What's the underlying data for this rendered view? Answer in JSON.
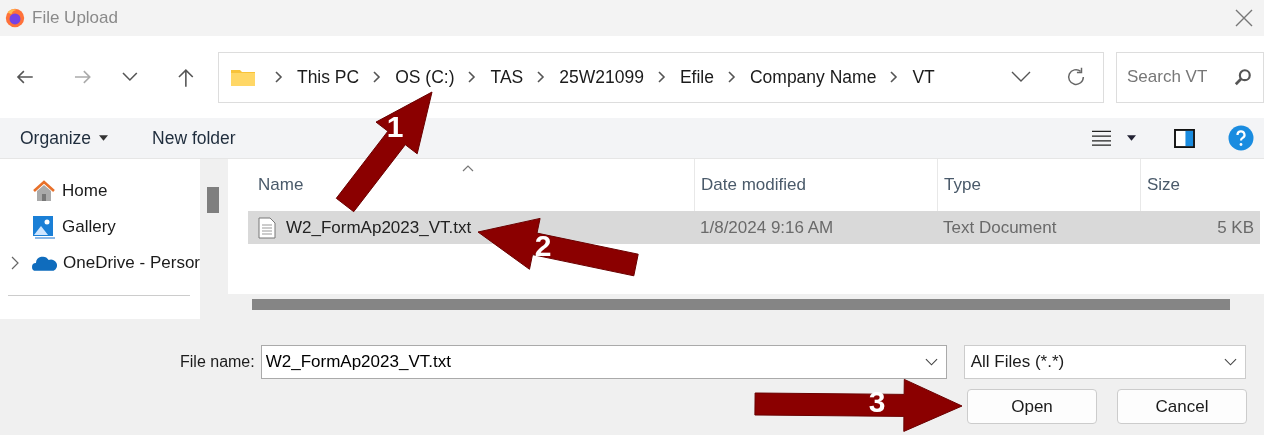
{
  "window": {
    "title": "File Upload"
  },
  "nav": {
    "breadcrumb": [
      "This PC",
      "OS (C:)",
      "TAS",
      "25W21099",
      "Efile",
      "Company Name",
      "VT"
    ],
    "search": {
      "placeholder": "Search VT"
    }
  },
  "toolbar": {
    "organize": "Organize",
    "new_folder": "New folder"
  },
  "sidebar": {
    "items": [
      {
        "label": "Home",
        "kind": "home",
        "expandable": false
      },
      {
        "label": "Gallery",
        "kind": "gallery",
        "expandable": false
      },
      {
        "label": "OneDrive - Persor",
        "kind": "cloud",
        "expandable": true
      }
    ]
  },
  "table": {
    "columns": [
      "Name",
      "Date modified",
      "Type",
      "Size"
    ],
    "rows": [
      {
        "name": "W2_FormAp2023_VT.txt",
        "date": "1/8/2024 9:16 AM",
        "type": "Text Document",
        "size": "5 KB",
        "selected": true
      }
    ]
  },
  "footer": {
    "file_name_label": "File name:",
    "file_name": "W2_FormAp2023_VT.txt",
    "file_type": "All Files (*.*)",
    "buttons": [
      "Open",
      "Cancel"
    ]
  },
  "callouts": [
    "1",
    "2",
    "3"
  ]
}
